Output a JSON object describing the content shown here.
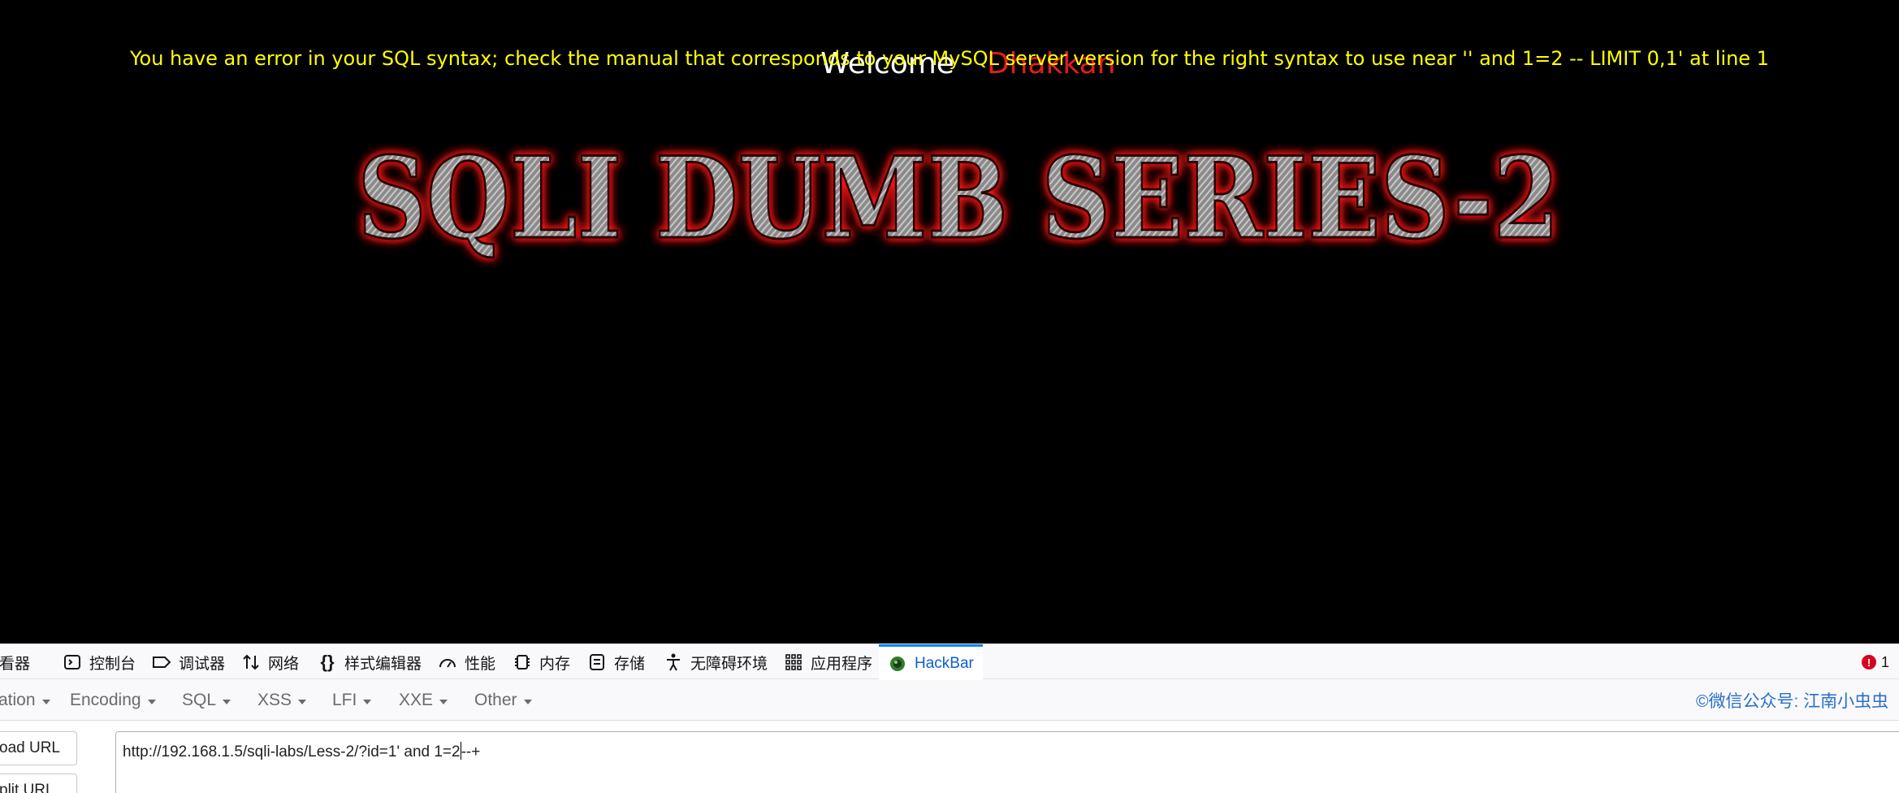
{
  "page": {
    "welcome_word": "Welcome",
    "welcome_name": "Dhakkan",
    "error_message": "You have an error in your SQL syntax; check the manual that corresponds to your MySQL server version for the right syntax to use near '' and 1=2 -- LIMIT 0,1' at line 1",
    "banner_text": "SQLI DUMB SERIES-2"
  },
  "devtools": {
    "tabs": [
      {
        "label": "查看器",
        "icon": "inspector-icon"
      },
      {
        "label": "控制台",
        "icon": "console-icon"
      },
      {
        "label": "调试器",
        "icon": "debugger-icon"
      },
      {
        "label": "网络",
        "icon": "network-icon"
      },
      {
        "label": "样式编辑器",
        "icon": "style-editor-icon"
      },
      {
        "label": "性能",
        "icon": "performance-icon"
      },
      {
        "label": "内存",
        "icon": "memory-icon"
      },
      {
        "label": "存储",
        "icon": "storage-icon"
      },
      {
        "label": "无障碍环境",
        "icon": "accessibility-icon"
      },
      {
        "label": "应用程序",
        "icon": "application-icon"
      },
      {
        "label": "HackBar",
        "icon": "hackbar-icon"
      }
    ],
    "active_tab": "HackBar",
    "error_count": "1"
  },
  "hackbar": {
    "menus": [
      {
        "label": "ation"
      },
      {
        "label": "Encoding"
      },
      {
        "label": "SQL"
      },
      {
        "label": "XSS"
      },
      {
        "label": "LFI"
      },
      {
        "label": "XXE"
      },
      {
        "label": "Other"
      }
    ],
    "wechat_label": "©微信公众号: 江南小虫虫",
    "load_url_label": "oad URL",
    "split_url_label": "plit URL",
    "url_before_cursor": "http://192.168.1.5/sqli-labs/Less-2/?id=1' and 1=2",
    "url_after_cursor": "--+"
  },
  "colors": {
    "background": "#000000",
    "welcome": "#ffffff",
    "name": "#e51c1c",
    "error": "#ffff00",
    "hackbar_active": "#0b5fd3"
  }
}
